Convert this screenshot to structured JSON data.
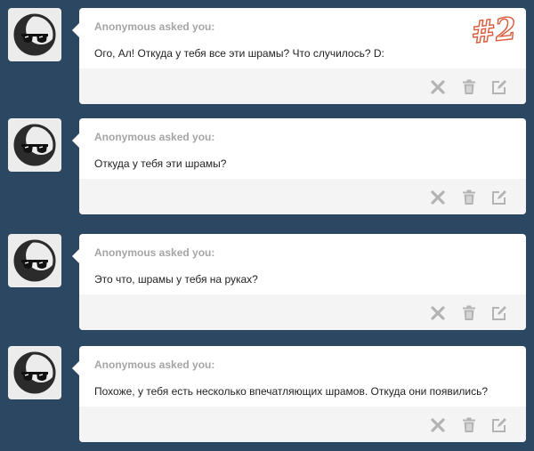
{
  "posts": [
    {
      "asker": "Anonymous asked you:",
      "question": "Ого, Ал! Откуда у тебя все эти шрамы? Что случилось? D:",
      "badge": "#2"
    },
    {
      "asker": "Anonymous asked you:",
      "question": "Откуда у тебя эти шрамы?"
    },
    {
      "asker": "Anonymous asked you:",
      "question": "Это что, шрамы у тебя на руках?"
    },
    {
      "asker": "Anonymous asked you:",
      "question": "Похоже, у тебя есть несколько впечатляющих шрамов. Откуда они появились?"
    }
  ],
  "icons": {
    "avatar": "sunglasses-moon-avatar",
    "dismiss": "x-icon",
    "delete": "trash-icon",
    "edit": "edit-icon"
  },
  "colors": {
    "background": "#2c4762",
    "asker_text": "#a5a5a5",
    "icon": "#b4b4b4",
    "badge": "#d9593a"
  }
}
